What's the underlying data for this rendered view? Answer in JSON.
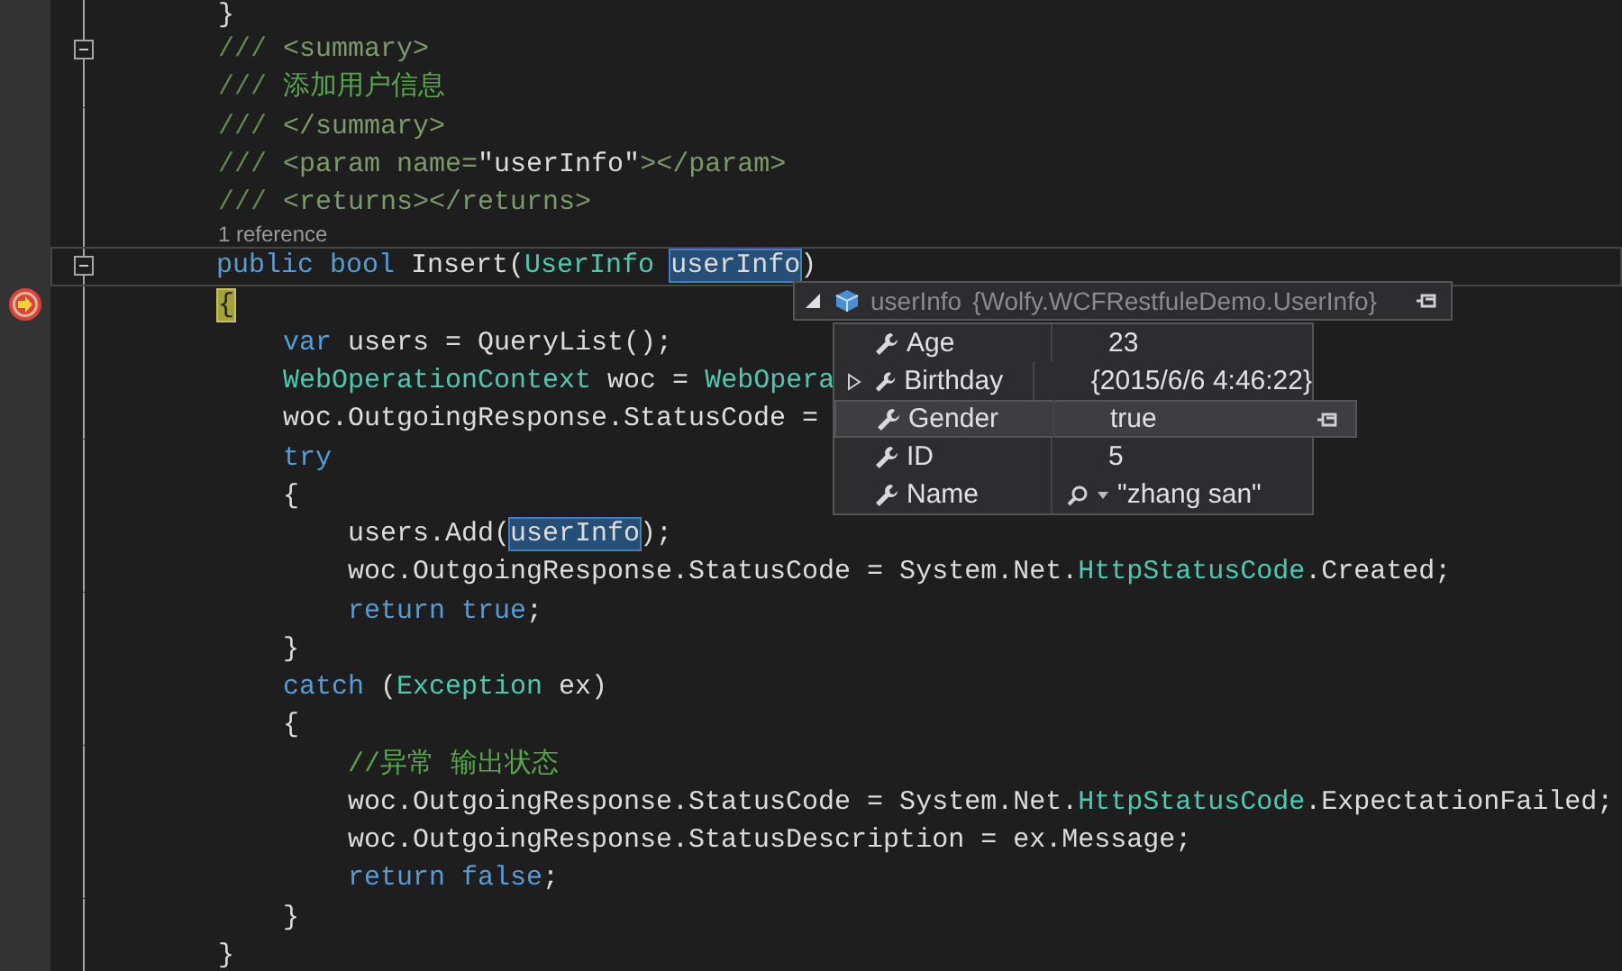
{
  "editor": {
    "lines": [
      {
        "kind": "code",
        "tokens": [
          {
            "kind": "plain",
            "text": "}"
          }
        ]
      },
      {
        "kind": "code",
        "fold": true,
        "tokens": [
          {
            "kind": "doc",
            "text": "/// "
          },
          {
            "kind": "doctag",
            "text": "<summary>"
          }
        ]
      },
      {
        "kind": "code",
        "tokens": [
          {
            "kind": "doc",
            "text": "/// "
          },
          {
            "kind": "comment",
            "text": "添加用户信息"
          }
        ]
      },
      {
        "kind": "code",
        "tokens": [
          {
            "kind": "doc",
            "text": "/// "
          },
          {
            "kind": "doctag",
            "text": "</summary>"
          }
        ]
      },
      {
        "kind": "code",
        "tokens": [
          {
            "kind": "doc",
            "text": "/// "
          },
          {
            "kind": "doctag",
            "text": "<param name="
          },
          {
            "kind": "plain",
            "text": "\"userInfo\""
          },
          {
            "kind": "doctag",
            "text": "></param>"
          }
        ]
      },
      {
        "kind": "code",
        "tokens": [
          {
            "kind": "doc",
            "text": "/// "
          },
          {
            "kind": "doctag",
            "text": "<returns></returns>"
          }
        ]
      },
      {
        "kind": "codelens",
        "tokens": [
          {
            "kind": "lens",
            "text": "1 reference"
          }
        ]
      },
      {
        "kind": "code",
        "fold": true,
        "caret_line": true,
        "tokens": [
          {
            "kind": "keyword",
            "text": "public"
          },
          {
            "kind": "keyword",
            "text": " bool"
          },
          {
            "kind": "plain",
            "text": " Insert("
          },
          {
            "kind": "type",
            "text": "UserInfo "
          },
          {
            "kind": "selected",
            "text": "userInfo"
          },
          {
            "kind": "plain",
            "text": ")"
          }
        ]
      },
      {
        "kind": "code",
        "breakpoint": true,
        "tokens": [
          {
            "kind": "current",
            "text": "{"
          }
        ]
      },
      {
        "kind": "code",
        "tokens": [
          {
            "kind": "keyword",
            "text": "    var"
          },
          {
            "kind": "plain",
            "text": " users = QueryList();"
          }
        ]
      },
      {
        "kind": "code",
        "tokens": [
          {
            "kind": "type",
            "text": "    WebOperationContext"
          },
          {
            "kind": "plain",
            "text": " woc = "
          },
          {
            "kind": "type",
            "text": "WebOpera"
          }
        ]
      },
      {
        "kind": "code",
        "tokens": [
          {
            "kind": "plain",
            "text": "    woc.OutgoingResponse.StatusCode ="
          }
        ]
      },
      {
        "kind": "code",
        "tokens": [
          {
            "kind": "keyword",
            "text": "    try"
          }
        ]
      },
      {
        "kind": "code",
        "tokens": [
          {
            "kind": "plain",
            "text": "    {"
          }
        ]
      },
      {
        "kind": "code",
        "tokens": [
          {
            "kind": "plain",
            "text": "        users.Add("
          },
          {
            "kind": "selected",
            "text": "userInfo"
          },
          {
            "kind": "plain",
            "text": ");"
          }
        ]
      },
      {
        "kind": "code",
        "tokens": [
          {
            "kind": "plain",
            "text": "        woc.OutgoingResponse.StatusCode = System.Net."
          },
          {
            "kind": "type",
            "text": "HttpStatusCode"
          },
          {
            "kind": "plain",
            "text": ".Created;"
          }
        ]
      },
      {
        "kind": "code",
        "tokens": [
          {
            "kind": "keyword",
            "text": "        return true"
          },
          {
            "kind": "plain",
            "text": ";"
          }
        ]
      },
      {
        "kind": "code",
        "tokens": [
          {
            "kind": "plain",
            "text": "    }"
          }
        ]
      },
      {
        "kind": "code",
        "tokens": [
          {
            "kind": "keyword",
            "text": "    catch"
          },
          {
            "kind": "plain",
            "text": " ("
          },
          {
            "kind": "type",
            "text": "Exception"
          },
          {
            "kind": "plain",
            "text": " ex)"
          }
        ]
      },
      {
        "kind": "code",
        "tokens": [
          {
            "kind": "plain",
            "text": "    {"
          }
        ]
      },
      {
        "kind": "code",
        "tokens": [
          {
            "kind": "comment",
            "text": "        //异常 输出状态"
          }
        ]
      },
      {
        "kind": "code",
        "tokens": [
          {
            "kind": "plain",
            "text": "        woc.OutgoingResponse.StatusCode = System.Net."
          },
          {
            "kind": "type",
            "text": "HttpStatusCode"
          },
          {
            "kind": "plain",
            "text": ".ExpectationFailed;"
          }
        ]
      },
      {
        "kind": "code",
        "tokens": [
          {
            "kind": "plain",
            "text": "        woc.OutgoingResponse.StatusDescription = ex.Message;"
          }
        ]
      },
      {
        "kind": "code",
        "tokens": [
          {
            "kind": "keyword",
            "text": "        return false"
          },
          {
            "kind": "plain",
            "text": ";"
          }
        ]
      },
      {
        "kind": "code",
        "tokens": [
          {
            "kind": "plain",
            "text": "    }"
          }
        ]
      },
      {
        "kind": "code",
        "tokens": [
          {
            "kind": "plain",
            "text": "}"
          }
        ]
      }
    ]
  },
  "datatip": {
    "expanded": true,
    "name": "userInfo",
    "value": "{Wolfy.WCFRestfuleDemo.UserInfo}",
    "members": [
      {
        "name": "Age",
        "value": "23",
        "expandable": false,
        "selected": false,
        "visualizer": false
      },
      {
        "name": "Birthday",
        "value": "{2015/6/6 4:46:22}",
        "expandable": true,
        "selected": false,
        "visualizer": false
      },
      {
        "name": "Gender",
        "value": "true",
        "expandable": false,
        "selected": true,
        "visualizer": false
      },
      {
        "name": "ID",
        "value": "5",
        "expandable": false,
        "selected": false,
        "visualizer": false
      },
      {
        "name": "Name",
        "value": "\"zhang san\"",
        "expandable": false,
        "selected": false,
        "visualizer": true
      }
    ]
  }
}
